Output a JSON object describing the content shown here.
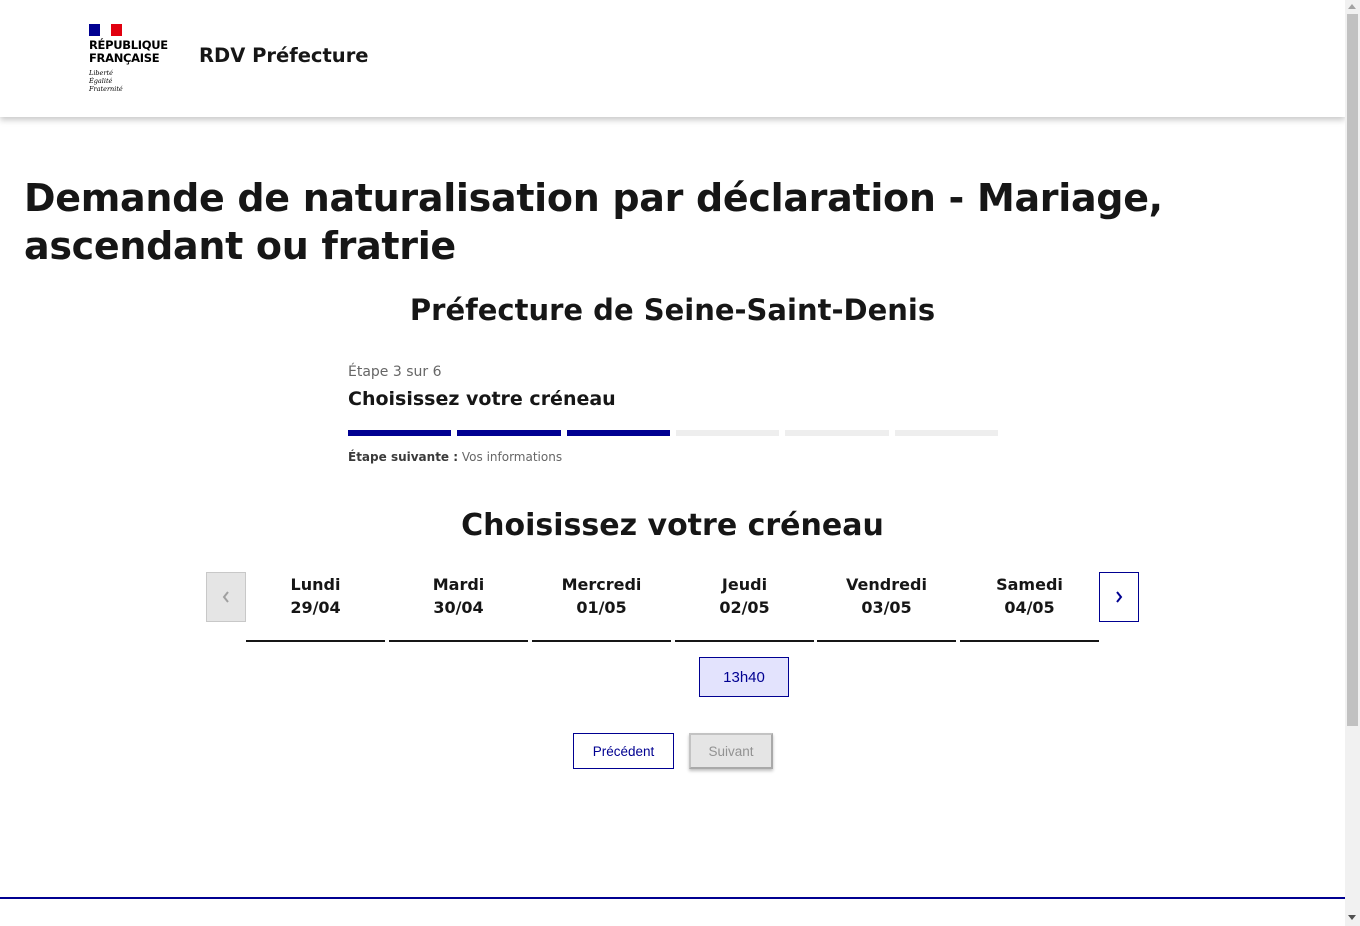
{
  "header": {
    "republique_line1": "RÉPUBLIQUE",
    "republique_line2": "FRANÇAISE",
    "motto": [
      "Liberté",
      "Égalité",
      "Fraternité"
    ],
    "service_name": "RDV Préfecture",
    "flag_colors": [
      "#000091",
      "#ffffff",
      "#e1000f"
    ]
  },
  "page": {
    "title": "Demande de naturalisation par déclaration - Mariage, ascendant ou fratrie",
    "prefecture": "Préfecture de Seine-Saint-Denis"
  },
  "stepper": {
    "count": "Étape 3 sur 6",
    "title": "Choisissez votre créneau",
    "current_step": 3,
    "total_steps": 6,
    "active_color": "#000091",
    "inactive_color": "#eeeeee",
    "next_label": "Étape suivante :",
    "next_value": "Vos informations"
  },
  "slots": {
    "title": "Choisissez votre créneau",
    "prev_icon": "chevron-left-icon",
    "next_icon": "chevron-right-icon",
    "days": [
      {
        "name": "Lundi",
        "date": "29/04"
      },
      {
        "name": "Mardi",
        "date": "30/04"
      },
      {
        "name": "Mercredi",
        "date": "01/05"
      },
      {
        "name": "Jeudi",
        "date": "02/05"
      },
      {
        "name": "Vendredi",
        "date": "03/05"
      },
      {
        "name": "Samedi",
        "date": "04/05"
      }
    ],
    "available": [
      {
        "day": "Jeudi 02/05",
        "time": "13h40"
      }
    ]
  },
  "actions": {
    "previous": "Précédent",
    "next": "Suivant"
  }
}
